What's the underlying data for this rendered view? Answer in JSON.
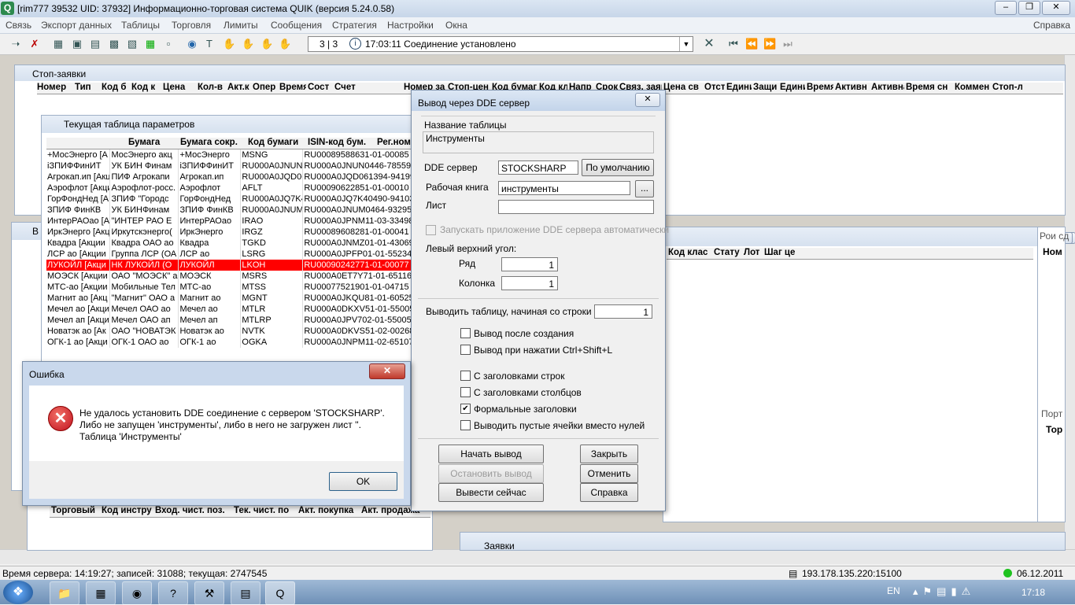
{
  "window": {
    "title": "[rim777 39532  UID: 37932] Информационно-торговая система QUIK (версия 5.24.0.58)"
  },
  "menu": [
    "Связь",
    "Экспорт данных",
    "Таблицы",
    "Торговля",
    "Лимиты",
    "Сообщения",
    "Стратегия",
    "Настройки",
    "Окна",
    "Справка"
  ],
  "toolbar": {
    "page_indicator": "3 | 3",
    "message": "17:03:11  Соединение установлено"
  },
  "stop_orders": {
    "title": "Стоп-заявки",
    "columns": [
      "Номер",
      "Тип",
      "Код б",
      "Код к",
      "Цена",
      "Кол-в",
      "Акт.к",
      "Опер",
      "Время",
      "Сост",
      "Счет",
      "Номер за",
      "Стоп-цен",
      "Код бумаг",
      "Код кл",
      "Напр",
      "Срок",
      "Связ. заяв",
      "Цена св",
      "Отст",
      "Едини",
      "Защи",
      "Едини",
      "Время",
      "Активн",
      "Активна",
      "Время сн",
      "Коммен",
      "Стоп-ли"
    ]
  },
  "params": {
    "title": "Текущая таблица параметров",
    "columns": [
      "Бумага",
      "Бумага сокр.",
      "Код бумаги",
      "ISIN-код бум.",
      "Рег.ном"
    ],
    "rows": [
      [
        "+МосЭнерго [А",
        "МосЭнерго акц",
        "+МосЭнерго",
        "MSNG",
        "RU00089588631-01-00085"
      ],
      [
        "iЗПИФФинИТ",
        "УК БИН Финам",
        "iЗПИФФинИТ",
        "RU000A0JNUN",
        "RU000A0JNUN0446-78559"
      ],
      [
        "Агрокап.ип [Акц",
        "ПИФ Агрокапи",
        "Агрокап.ип",
        "RU000A0JQD06",
        "RU000A0JQD061394-94199"
      ],
      [
        "Аэрофлот [Акци",
        "Аэрофлот-росс.",
        "Аэрофлот",
        "AFLT",
        "RU00090622851-01-00010"
      ],
      [
        "ГорФондНед [А",
        "ЗПИФ \"Городс",
        "ГорФондНед",
        "RU000A0JQ7K4",
        "RU000A0JQ7K40490-94103"
      ],
      [
        "ЗПИФ ФинКВ",
        "УК БИНФинам",
        "ЗПИФ ФинКВ",
        "RU000A0JNUM",
        "RU000A0JNUM0464-93295"
      ],
      [
        "ИнтерРАОао [А",
        "\"ИНТЕР РАО Е",
        "ИнтерРАОао",
        "IRAO",
        "RU000A0JPNM11-03-33498"
      ],
      [
        "ИркЭнерго [Акц",
        "Иркутскэнерго(",
        "ИркЭнерго",
        "IRGZ",
        "RU00089608281-01-00041"
      ],
      [
        "Квадра [Акции",
        "Квадра ОАО ао",
        "Квадра",
        "TGKD",
        "RU000A0JNMZ01-01-43069"
      ],
      [
        "ЛСР ао [Акции",
        "Группа ЛСР (ОА",
        "ЛСР ао",
        "LSRG",
        "RU000A0JPFP01-01-55234"
      ],
      [
        "ЛУКОЙЛ [Акци",
        "НК ЛУКОЙЛ (О",
        "ЛУКОЙЛ",
        "LKOH",
        "RU00090242771-01-00077"
      ],
      [
        "МОЭСК [Акции",
        "ОАО \"МОЭСК\" а",
        "МОЭСК",
        "MSRS",
        "RU000A0ET7Y71-01-65116"
      ],
      [
        "МТС-ао [Акции",
        "Мобильные Тел",
        "МТС-ао",
        "MTSS",
        "RU00077521901-01-04715"
      ],
      [
        "Магнит ао [Акц",
        "\"Магнит\" ОАО а",
        "Магнит ао",
        "MGNT",
        "RU000A0JKQU81-01-60525"
      ],
      [
        "Мечел ао [Акци",
        "Мечел ОАО ао",
        "Мечел ао",
        "MTLR",
        "RU000A0DKXV51-01-55005"
      ],
      [
        "Мечел ап [Акци",
        "Мечел ОАО ап",
        "Мечел ап",
        "MTLRP",
        "RU000A0JPV702-01-55005"
      ],
      [
        "Новатэк ао [Ак",
        "ОАО \"НОВАТЭК",
        "Новатэк ао",
        "NVTK",
        "RU000A0DKVS51-02-00268"
      ],
      [
        "ОГК-1 ао [Акци",
        "ОГК-1 ОАО ао",
        "ОГК-1 ао",
        "OGKA",
        "RU000A0JNPM11-02-65107"
      ]
    ],
    "highlight_color": "#ff0000"
  },
  "right_panel": {
    "columns": [
      "Код клас",
      "Стату",
      "Лот",
      "Шаг це",
      "Ном"
    ]
  },
  "bottom_left": {
    "columns": [
      "Торговый",
      "Код инстру",
      "Вход. чист. поз.",
      "Тек. чист. по",
      "Акт. покупка",
      "Акт. продажа"
    ]
  },
  "orders_panel": {
    "title": "Заявки"
  },
  "edge_labels": {
    "port": "Порт",
    "tor": "Тор",
    "oi_sd": "Рои сд",
    "v": "В"
  },
  "dde": {
    "title": "Вывод через DDE сервер",
    "table_name_label": "Название таблицы",
    "table_name": "Инструменты",
    "dde_server_label": "DDE сервер",
    "dde_server": "STOCKSHARP",
    "default_btn": "По умолчанию",
    "workbook_label": "Рабочая книга",
    "workbook": "инструменты",
    "browse_btn": "...",
    "sheet_label": "Лист",
    "sheet": "",
    "autostart_label": "Запускать приложение DDE сервера автоматически",
    "topleft_label": "Левый верхний угол:",
    "row_label": "Ряд",
    "row_value": "1",
    "col_label": "Колонка",
    "col_value": "1",
    "start_row_label": "Выводить таблицу,  начиная со строки",
    "start_row_value": "1",
    "cb_after_create": "Вывод после создания",
    "cb_hotkey": "Вывод при нажатии Ctrl+Shift+L",
    "cb_row_headers": "С заголовками строк",
    "cb_col_headers": "С заголовками столбцов",
    "cb_formal": "Формальные заголовки",
    "cb_empty": "Выводить пустые ячейки вместо нулей",
    "btn_start": "Начать вывод",
    "btn_stop": "Остановить вывод",
    "btn_now": "Вывести сейчас",
    "btn_close": "Закрыть",
    "btn_cancel": "Отменить",
    "btn_help": "Справка"
  },
  "error": {
    "title": "Ошибка",
    "line1": "Не удалось установить DDE соединение с сервером 'STOCKSHARP'.",
    "line2": "Либо не запущен 'инструменты', либо в него не загружен лист ''.",
    "line3": "Таблица 'Инструменты'",
    "ok": "OK"
  },
  "status": {
    "text": "Время сервера: 14:19:27; записей: 31088; текущая: 2747545",
    "server": "193.178.135.220:15100",
    "date": "06.12.2011"
  },
  "taskbar": {
    "lang": "EN",
    "time": "17:18"
  }
}
